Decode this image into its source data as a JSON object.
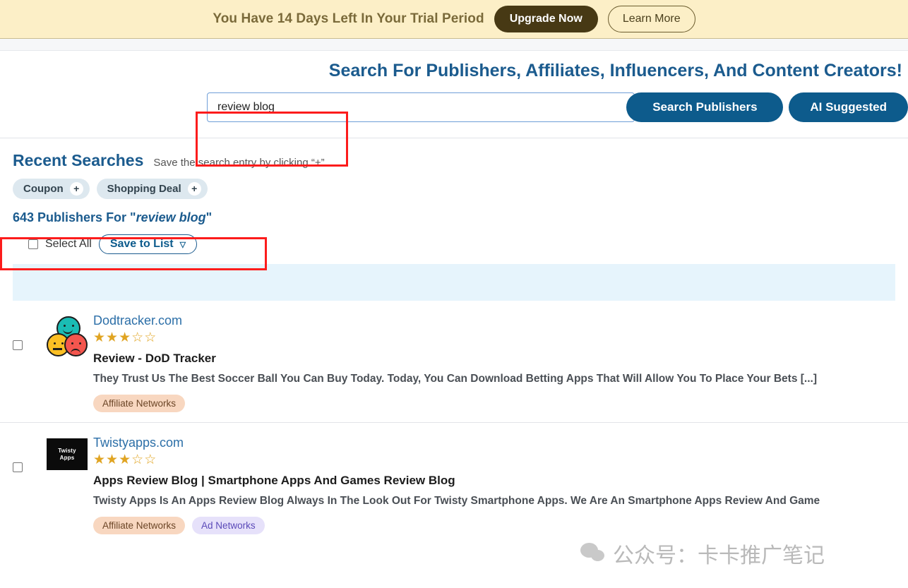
{
  "trial_banner": {
    "message": "You Have 14 Days Left In Your Trial Period",
    "upgrade_label": "Upgrade Now",
    "learn_more_label": "Learn More",
    "bg_color": "#fcefc7",
    "upgrade_color": "#473914"
  },
  "search": {
    "heading": "Search For Publishers, Affiliates, Influencers, And Content Creators!",
    "input_value": "review blog",
    "input_placeholder": "",
    "search_button_label": "Search Publishers",
    "ai_button_label": "AI Suggested",
    "accent_color": "#0d5b8c",
    "highlight_color": "#fc1c1c"
  },
  "recent_searches": {
    "title": "Recent Searches",
    "hint": "Save the search entry by clicking “+”.",
    "chips": [
      {
        "label": "Coupon",
        "add": "+"
      },
      {
        "label": "Shopping Deal",
        "add": "+"
      }
    ]
  },
  "results_header": {
    "count_prefix": "643 Publishers For \"",
    "count_query": "review blog",
    "count_suffix": "\"",
    "select_all_label": "Select All",
    "save_to_list_label": "Save to List",
    "caret": "▽"
  },
  "results": [
    {
      "domain": "Dodtracker.com",
      "rating": 3,
      "rating_max": 5,
      "title": "Review - DoD Tracker",
      "description": "They Trust Us The Best Soccer Ball You Can Buy Today. Today, You Can Download Betting Apps That Will Allow You To Place Your Bets [...]",
      "icon": "three-faces-icon",
      "tags": [
        "Affiliate Networks"
      ]
    },
    {
      "domain": "Twistyapps.com",
      "rating": 3,
      "rating_max": 5,
      "title": "Apps Review Blog | Smartphone Apps And Games Review Blog",
      "description": "Twisty Apps Is An Apps Review Blog Always In The Look Out For Twisty Smartphone Apps. We Are An Smartphone Apps Review And Game",
      "icon": "twisty-apps-logo",
      "icon_text_line1": "Twisty",
      "icon_text_line2": "Apps",
      "tags": [
        "Affiliate Networks",
        "Ad Networks"
      ]
    }
  ],
  "watermark": {
    "text": "公众号：卡卡推广笔记"
  },
  "glyphs": {
    "star_filled": "★",
    "star_empty": "☆"
  }
}
